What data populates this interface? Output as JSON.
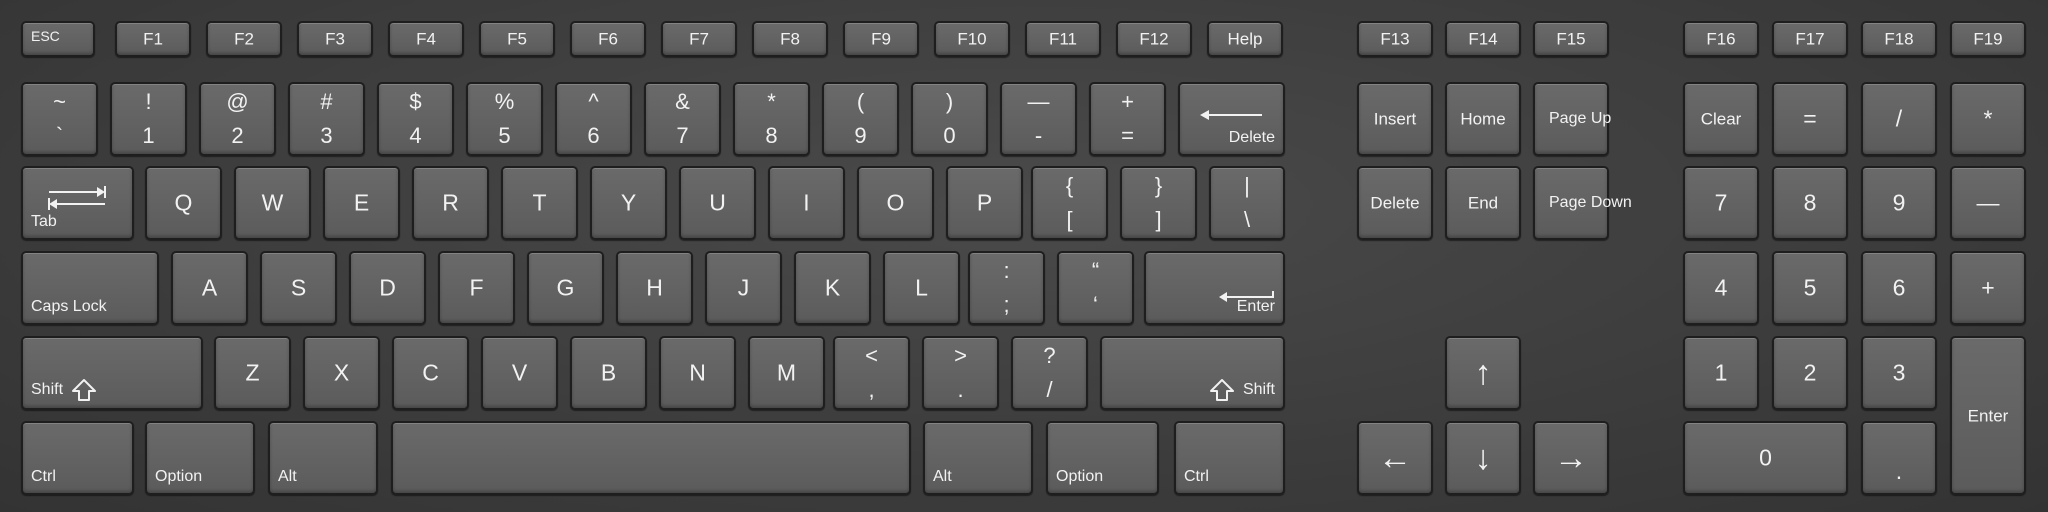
{
  "function_row": {
    "esc": "ESC",
    "f1": "F1",
    "f2": "F2",
    "f3": "F3",
    "f4": "F4",
    "f5": "F5",
    "f6": "F6",
    "f7": "F7",
    "f8": "F8",
    "f9": "F9",
    "f10": "F10",
    "f11": "F11",
    "f12": "F12",
    "help": "Help",
    "f13": "F13",
    "f14": "F14",
    "f15": "F15",
    "f16": "F16",
    "f17": "F17",
    "f18": "F18",
    "f19": "F19"
  },
  "number_row": {
    "tilde_top": "~",
    "tilde_bottom": "`",
    "d1_top": "!",
    "d1_bottom": "1",
    "d2_top": "@",
    "d2_bottom": "2",
    "d3_top": "#",
    "d3_bottom": "3",
    "d4_top": "$",
    "d4_bottom": "4",
    "d5_top": "%",
    "d5_bottom": "5",
    "d6_top": "^",
    "d6_bottom": "6",
    "d7_top": "&",
    "d7_bottom": "7",
    "d8_top": "*",
    "d8_bottom": "8",
    "d9_top": "(",
    "d9_bottom": "9",
    "d0_top": ")",
    "d0_bottom": "0",
    "minus_top": "—",
    "minus_bottom": "-",
    "plus_top": "+",
    "plus_bottom": "=",
    "delete": "Delete"
  },
  "qwerty_row": {
    "tab": "Tab",
    "q": "Q",
    "w": "W",
    "e": "E",
    "r": "R",
    "t": "T",
    "y": "Y",
    "u": "U",
    "i": "I",
    "o": "O",
    "p": "P",
    "lbrace_top": "{",
    "lbrace_bottom": "[",
    "rbrace_top": "}",
    "rbrace_bottom": "]",
    "pipe_top": "|",
    "pipe_bottom": "\\"
  },
  "home_row": {
    "caps_lock": "Caps Lock",
    "a": "A",
    "s": "S",
    "d": "D",
    "f": "F",
    "g": "G",
    "h": "H",
    "j": "J",
    "k": "K",
    "l": "L",
    "colon_top": ":",
    "colon_bottom": ";",
    "quote_top": "“",
    "quote_bottom": "‘",
    "enter": "Enter"
  },
  "shift_row": {
    "shift_left": "Shift",
    "z": "Z",
    "x": "X",
    "c": "C",
    "v": "V",
    "b": "B",
    "n": "N",
    "m": "M",
    "lt_top": "<",
    "lt_bottom": ",",
    "gt_top": ">",
    "gt_bottom": ".",
    "q_top": "?",
    "q_bottom": "/",
    "shift_right": "Shift"
  },
  "bottom_row": {
    "ctrl_left": "Ctrl",
    "option_left": "Option",
    "alt_left": "Alt",
    "alt_right": "Alt",
    "option_right": "Option",
    "ctrl_right": "Ctrl"
  },
  "nav_cluster": {
    "insert": "Insert",
    "home": "Home",
    "page_up": "Page Up",
    "delete": "Delete",
    "end": "End",
    "page_down": "Page Down",
    "arrow_up": "↑",
    "arrow_left": "←",
    "arrow_down": "↓",
    "arrow_right": "→"
  },
  "numpad": {
    "clear": "Clear",
    "equals": "=",
    "divide": "/",
    "multiply": "*",
    "n7": "7",
    "n8": "8",
    "n9": "9",
    "minus": "—",
    "n4": "4",
    "n5": "5",
    "n6": "6",
    "plus": "+",
    "n1": "1",
    "n2": "2",
    "n3": "3",
    "enter": "Enter",
    "n0": "0",
    "dot": "."
  },
  "icons": {
    "tab": "tab-arrows-icon",
    "backspace": "left-arrow-icon",
    "enter": "return-arrow-icon",
    "shift": "shift-arrow-icon"
  },
  "colors": {
    "key_face": "#626262",
    "key_border": "#1e1e1e",
    "background": "#3c3c3c",
    "legend": "#f2f2f2"
  }
}
